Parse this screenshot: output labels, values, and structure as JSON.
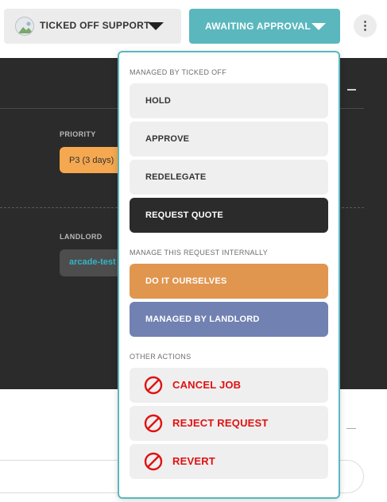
{
  "header": {
    "assignee_label": "TICKED OFF SUPPORT",
    "status_label": "AWAITING APPROVAL",
    "more_icon": "⋮"
  },
  "details": {
    "priority_label": "PRIORITY",
    "priority_value": "P3 (3 days)",
    "landlord_label": "LANDLORD",
    "landlord_value": "arcade-test"
  },
  "status_menu": {
    "sections": [
      {
        "title": "MANAGED BY TICKED OFF"
      },
      {
        "title": "MANAGE THIS REQUEST INTERNALLY"
      },
      {
        "title": "OTHER ACTIONS"
      }
    ],
    "items": [
      {
        "label": "HOLD"
      },
      {
        "label": "APPROVE"
      },
      {
        "label": "REDELEGATE"
      },
      {
        "label": "REQUEST QUOTE"
      },
      {
        "label": "DO IT OURSELVES"
      },
      {
        "label": "MANAGED BY LANDLORD"
      },
      {
        "label": "CANCEL JOB",
        "icon": "ban-icon"
      },
      {
        "label": "REJECT REQUEST",
        "icon": "ban-icon"
      },
      {
        "label": "REVERT",
        "icon": "ban-icon"
      }
    ]
  },
  "colors": {
    "accent": "#5ab7be",
    "dark_panel": "#2b2b2b",
    "priority_chip": "#f5a850",
    "orange_action": "#e0964f",
    "purple_action": "#7181b1",
    "danger": "#e01111"
  }
}
